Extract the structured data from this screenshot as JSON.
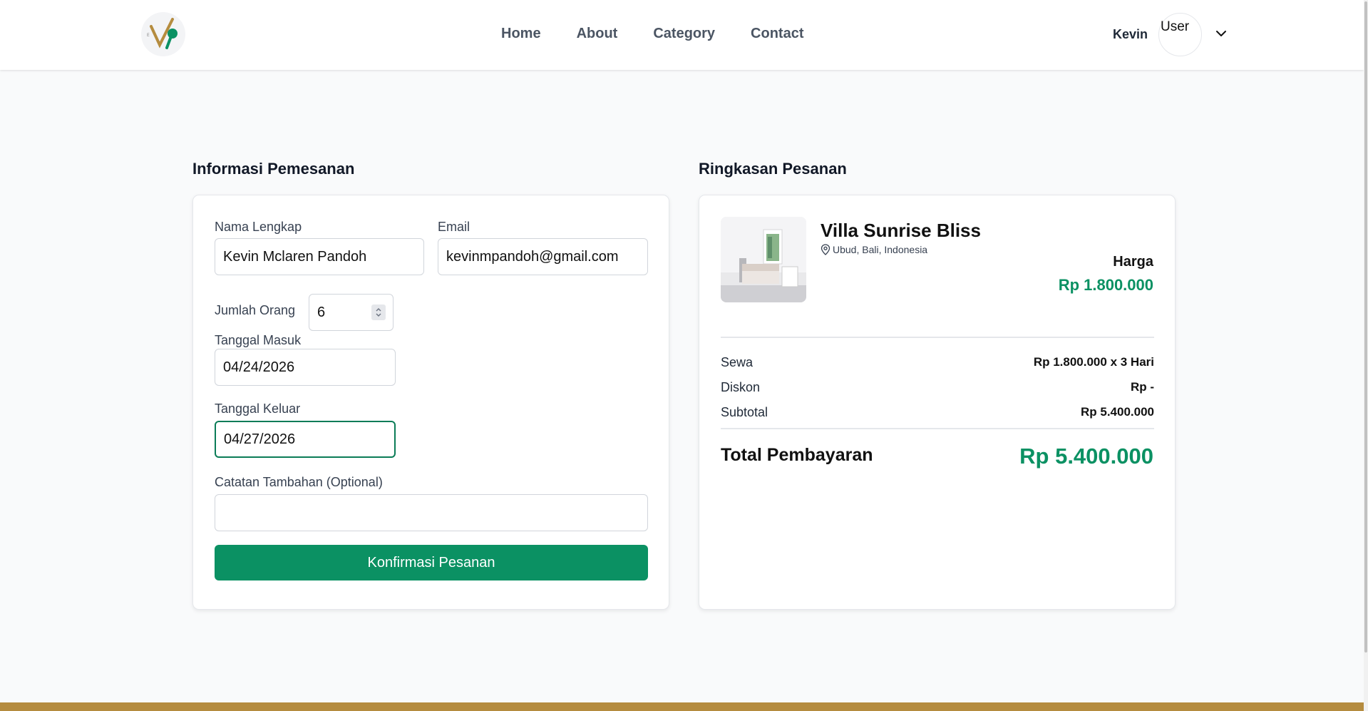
{
  "header": {
    "nav": [
      "Home",
      "About",
      "Category",
      "Contact"
    ],
    "user_name": "Kevin",
    "avatar_text": "User"
  },
  "form": {
    "title": "Informasi Pemesanan",
    "full_name_label": "Nama Lengkap",
    "full_name_value": "Kevin Mclaren Pandoh",
    "email_label": "Email",
    "email_value": "kevinmpandoh@gmail.com",
    "people_label": "Jumlah Orang",
    "people_value": "6",
    "checkin_label": "Tanggal Masuk",
    "checkin_value": "04/24/2026",
    "checkout_label": "Tanggal Keluar",
    "checkout_value": "04/27/2026",
    "notes_label": "Catatan Tambahan (Optional)",
    "notes_value": "",
    "confirm_label": "Konfirmasi Pesanan"
  },
  "summary": {
    "title": "Ringkasan Pesanan",
    "villa_name": "Villa Sunrise Bliss",
    "location": "Ubud, Bali, Indonesia",
    "price_label": "Harga",
    "price_value": "Rp 1.800.000",
    "rows": [
      {
        "label": "Sewa",
        "value": "Rp 1.800.000 x 3 Hari"
      },
      {
        "label": "Diskon",
        "value": "Rp -"
      },
      {
        "label": "Subtotal",
        "value": "Rp 5.400.000"
      }
    ],
    "total_label": "Total Pembayaran",
    "total_value": "Rp 5.400.000"
  },
  "colors": {
    "accent": "#0b9163",
    "footer": "#b58c3f"
  }
}
